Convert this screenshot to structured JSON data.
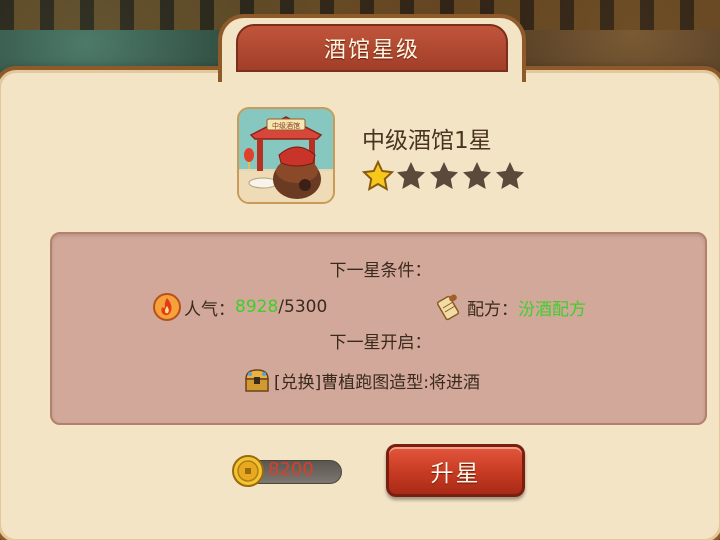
{
  "title": "酒馆星级",
  "tavern": {
    "name": "中级酒馆1星",
    "sign_text": "中级酒馆",
    "stars_total": 5,
    "stars_filled": 1
  },
  "next_star": {
    "conditions_title": "下一星条件：",
    "popularity": {
      "label": "人气：",
      "current": "8928",
      "separator": "/",
      "required": "5300"
    },
    "recipe": {
      "label": "配方：",
      "value": "汾酒配方"
    },
    "unlock_title": "下一星开启：",
    "reward": "[兑换]曹植跑图造型:将进酒"
  },
  "cost": {
    "amount": "8200"
  },
  "upgrade_button": "升星",
  "colors": {
    "accent_red": "#c63a22",
    "met_green": "#3fcf2a",
    "cost_red": "#d8402a",
    "star_gold": "#f7c81c",
    "star_empty": "#5a4a3c"
  },
  "icons": {
    "popularity": "fire-icon",
    "recipe": "scroll-icon",
    "reward": "treasure-chest-icon",
    "cost": "coin-icon"
  }
}
